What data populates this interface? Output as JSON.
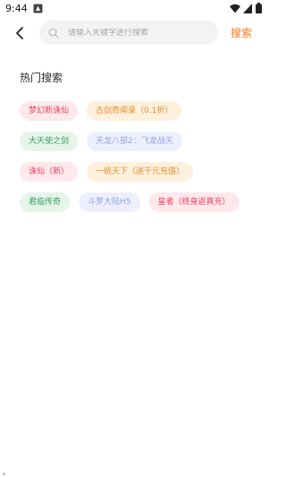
{
  "status_bar": {
    "time": "9:44"
  },
  "header": {
    "search_placeholder": "请输入关键字进行搜索",
    "search_value": "",
    "search_button_label": "搜索",
    "accent_color": "#ff7a1a"
  },
  "hot_search": {
    "title": "热门搜索",
    "rows": [
      [
        {
          "label": "梦幻新诛仙",
          "color": "red"
        },
        {
          "label": "古剑奇闻录（0.1折）",
          "color": "orange"
        }
      ],
      [
        {
          "label": "大天使之剑",
          "color": "green"
        },
        {
          "label": "天龙八部2：飞龙战天",
          "color": "blue"
        }
      ],
      [
        {
          "label": "诛仙（新）",
          "color": "red"
        },
        {
          "label": "一统天下（送千元充值）",
          "color": "orange"
        }
      ],
      [
        {
          "label": "君临传奇",
          "color": "green"
        },
        {
          "label": "斗罗大陆H5",
          "color": "blue"
        },
        {
          "label": "皇者（终身返真充）",
          "color": "red"
        }
      ]
    ]
  },
  "tag_colors": {
    "red": {
      "bg": "#fde8ec",
      "fg": "#e8445c"
    },
    "orange": {
      "bg": "#fdf1dd",
      "fg": "#e58a2a"
    },
    "green": {
      "bg": "#e6f4ea",
      "fg": "#34a05a"
    },
    "blue": {
      "bg": "#edf0fc",
      "fg": "#8fa3e3"
    }
  }
}
